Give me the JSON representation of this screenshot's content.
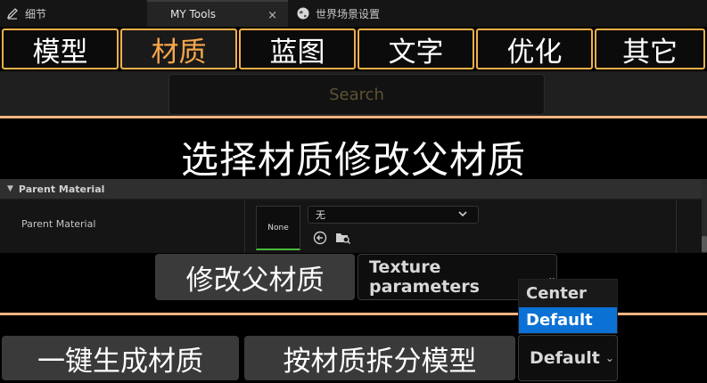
{
  "tabs": {
    "details": "细节",
    "active": "MY Tools",
    "world": "世界场景设置",
    "close": "×"
  },
  "categories": [
    "模型",
    "材质",
    "蓝图",
    "文字",
    "优化",
    "其它"
  ],
  "selected_category": "材质",
  "search": {
    "placeholder": "Search"
  },
  "section_title": "选择材质修改父材质",
  "details_panel": {
    "header": "Parent Material",
    "row_label": "Parent Material",
    "thumbnail_text": "None",
    "combo_value": "无"
  },
  "actions": {
    "modify_parent": "修改父材质",
    "texture_dropdown": "Texture parameters",
    "one_click_generate": "一键生成材质",
    "split_by_material": "按材质拆分模型",
    "pivot_dropdown": "Default"
  },
  "pivot_menu": {
    "options": [
      "Center",
      "Default"
    ],
    "selected": "Default"
  },
  "colors": {
    "accent_orange": "#f3b04b",
    "selected_text": "#f6a64a",
    "menu_selected": "#0b71d4"
  }
}
